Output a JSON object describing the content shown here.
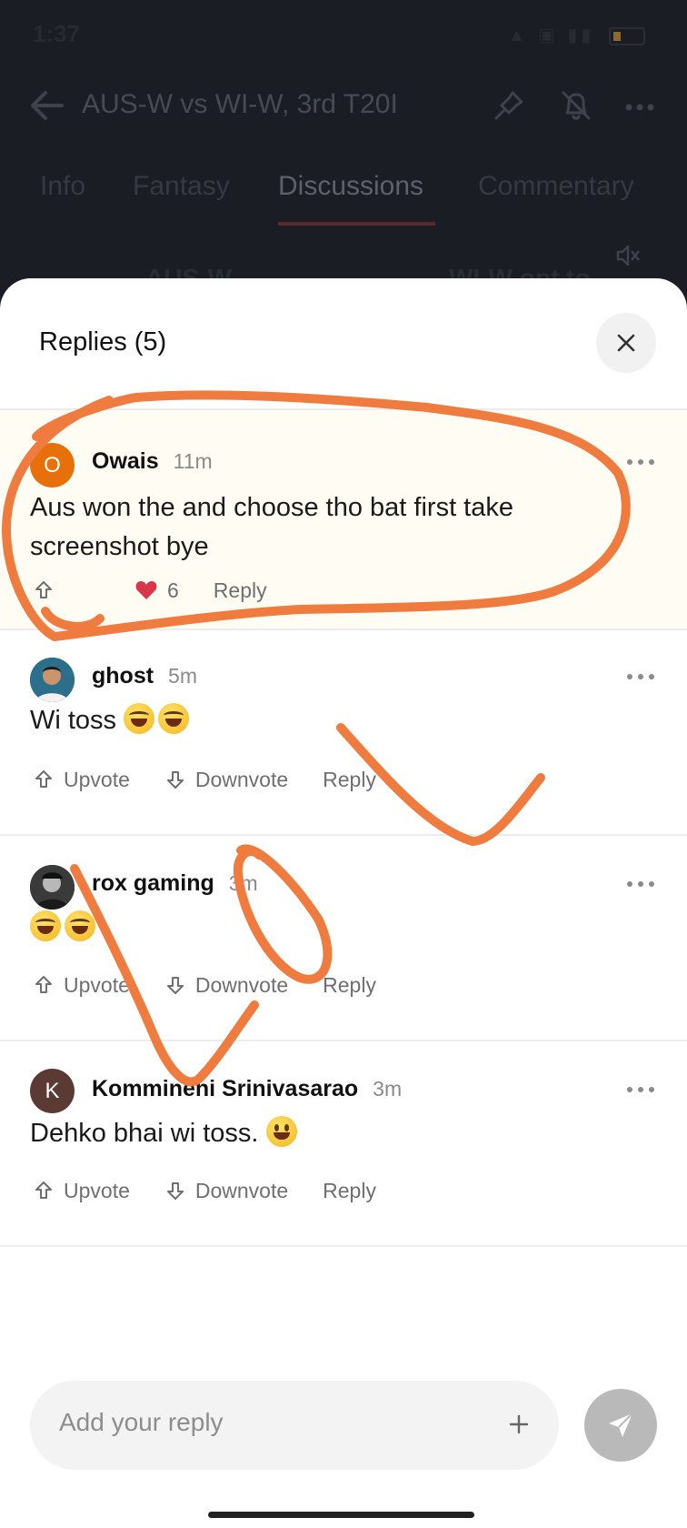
{
  "status_bar": {
    "time": "1:37"
  },
  "app_bar": {
    "title": "AUS-W vs WI-W, 3rd T20I"
  },
  "tabs": [
    {
      "label": "Info",
      "active": false
    },
    {
      "label": "Fantasy",
      "active": false
    },
    {
      "label": "Discussions",
      "active": true
    },
    {
      "label": "Commentary",
      "active": false
    }
  ],
  "background_peek": {
    "left": "AUS-W",
    "right": "WI-W opt to"
  },
  "sheet": {
    "title": "Replies (5)",
    "replies": [
      {
        "avatar_letter": "O",
        "avatar_color": "#e8700a",
        "author": "Owais",
        "time": "11m",
        "text": "Aus won the and choose tho bat first take screenshot bye",
        "likes": "6",
        "reply_label": "Reply",
        "highlighted": true
      },
      {
        "avatar_letter": "",
        "avatar_color": "#1e3c4a",
        "author": "ghost",
        "time": "5m",
        "text": "Wi toss",
        "emojis": [
          "laugh",
          "laugh"
        ],
        "upvote_label": "Upvote",
        "downvote_label": "Downvote",
        "reply_label": "Reply"
      },
      {
        "avatar_letter": "",
        "avatar_color": "#2b2b2b",
        "author": "rox gaming",
        "time": "3m",
        "text": "",
        "emojis": [
          "laugh",
          "laugh"
        ],
        "upvote_label": "Upvote",
        "downvote_label": "Downvote",
        "reply_label": "Reply"
      },
      {
        "avatar_letter": "K",
        "avatar_color": "#5a3a32",
        "author": "Kommineni Srinivasarao",
        "time": "3m",
        "text": "Dehko bhai wi toss.",
        "emojis": [
          "smile"
        ],
        "upvote_label": "Upvote",
        "downvote_label": "Downvote",
        "reply_label": "Reply"
      }
    ]
  },
  "composer": {
    "placeholder": "Add your reply"
  },
  "colors": {
    "annotation": "#f07b3f",
    "accent": "#e8700a"
  }
}
